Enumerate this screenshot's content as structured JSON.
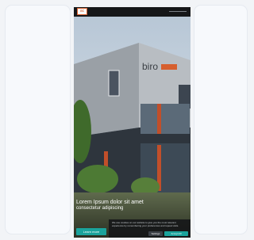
{
  "page": {
    "background_color": "#f2f4f7",
    "accent_color": "#1aa39c",
    "brand_color": "#d65f2e"
  },
  "header": {
    "logo_icon": "brand-logo-icon",
    "logo_text": "ac"
  },
  "hero": {
    "image_icon": "office-building-photo",
    "building_sign": "biro",
    "caption_line1": "Lorem Ipsum dolor sit amet",
    "caption_line2": "consectetur adipiscing",
    "button_label": "Learn more"
  },
  "cookie_banner": {
    "text": "We use cookies on our website to give you the most relevant experience by remembering your preferences and repeat visits.",
    "settings_label": "Settings",
    "accept_label": "Accept All"
  }
}
